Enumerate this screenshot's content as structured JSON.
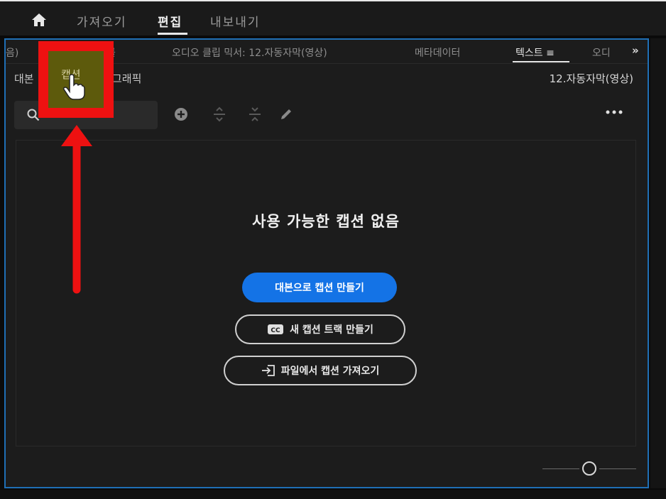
{
  "header": {
    "home_icon": "home-icon",
    "tabs": [
      {
        "label": "가져오기",
        "active": false
      },
      {
        "label": "편집",
        "active": true
      },
      {
        "label": "내보내기",
        "active": false
      }
    ]
  },
  "panel_tabs": {
    "items": [
      {
        "label": "음)"
      },
      {
        "label": "효과 컨트롤"
      },
      {
        "label": "오디오 클립 믹서: 12.자동자막(영상)"
      },
      {
        "label": "메타데이터"
      },
      {
        "label": "텍스트 ≡"
      },
      {
        "label": "오디"
      }
    ],
    "overflow_label": "»"
  },
  "text_panel": {
    "subtabs": [
      {
        "label": "대본"
      },
      {
        "label": "캡션"
      },
      {
        "label": "그래픽"
      }
    ],
    "sequence_name": "12.자동자막(영상)",
    "search_icon": "search-icon",
    "tool_icons": [
      "add-caption-icon",
      "merge-icon",
      "split-icon",
      "edit-icon"
    ],
    "menu_icon": "more-icon",
    "empty_message": "사용 가능한 캡션 없음",
    "buttons": {
      "from_transcript": "대본으로 캡션 만들기",
      "new_track": "새 캡션 트랙 만들기",
      "import_file": "파일에서 캡션 가져오기"
    }
  },
  "annotation": {
    "color": "#ee1111",
    "highlighted_tab": "캡션",
    "pointer_icon": "hand-pointer-icon"
  },
  "colors": {
    "accent": "#1473e6",
    "frame": "#1f6fb5",
    "panel_bg": "#1c1c1c"
  }
}
